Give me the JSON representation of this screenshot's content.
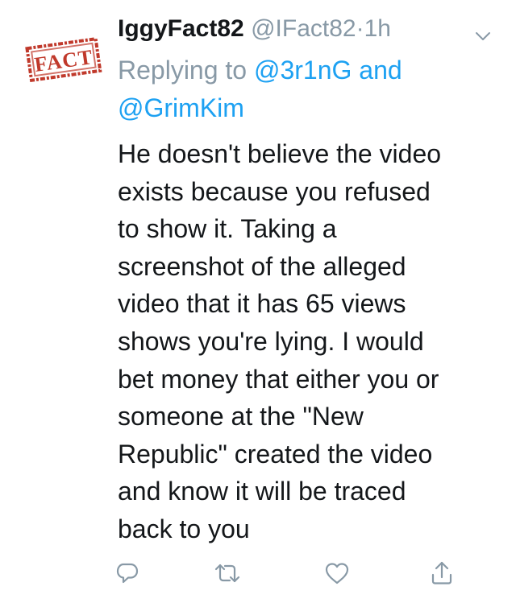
{
  "tweet": {
    "display_name": "IggyFact82",
    "handle": "@IFact82",
    "separator": "·",
    "time": "1h",
    "avatar_stamp": "FACT",
    "reply": {
      "prefix": "Replying to ",
      "mention1": "@3r1nG",
      "connector": " and ",
      "mention2": "@GrimKim"
    },
    "body": "He doesn't believe the video\nexists because you refused\nto show it.  Taking a\nscreenshot of the alleged\nvideo that it has 65 views\nshows you're lying.  I would\nbet money that either you or\nsomeone at the \"New\nRepublic\" created the video\nand know it will be traced\nback to you"
  },
  "icons": {
    "menu": "chevron-down-icon",
    "reply": "reply-icon",
    "retweet": "retweet-icon",
    "like": "heart-icon",
    "share": "share-icon"
  },
  "colors": {
    "text": "#14171a",
    "muted": "#8899a6",
    "link": "#1da1f2",
    "stamp": "#c0392b"
  }
}
